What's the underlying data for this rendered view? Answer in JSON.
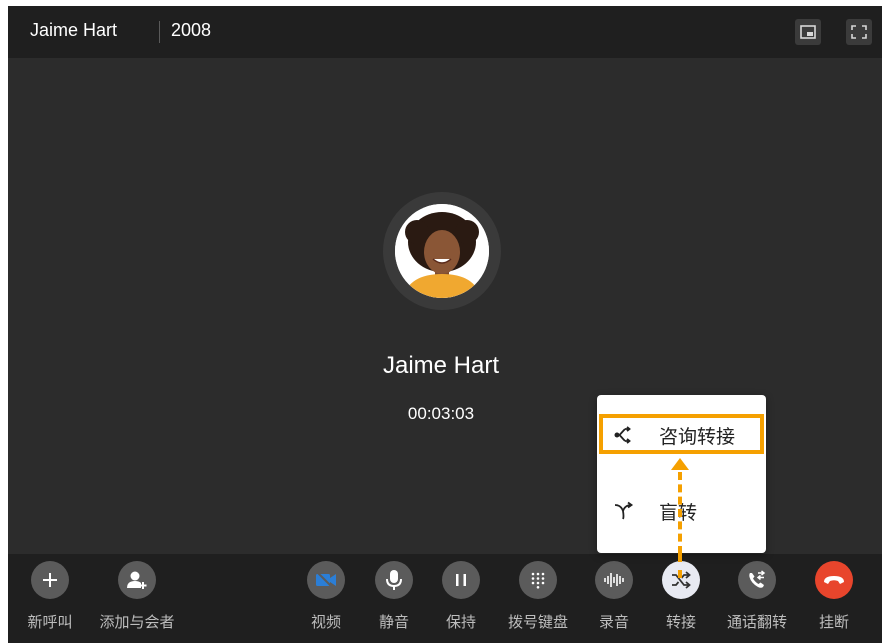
{
  "titlebar": {
    "name": "Jaime Hart",
    "extension": "2008",
    "buttons": [
      {
        "icon": "picture-in-picture-icon"
      },
      {
        "icon": "fullscreen-icon"
      }
    ]
  },
  "call": {
    "avatar_icon": "caller-avatar",
    "caller_name": "Jaime Hart",
    "duration": "00:03:03"
  },
  "toolbar": {
    "new_call": {
      "label": "新呼叫",
      "icon": "plus-icon"
    },
    "add_participant": {
      "label": "添加与会者",
      "icon": "add-user-icon"
    },
    "video": {
      "label": "视频",
      "icon": "video-off-icon"
    },
    "mute": {
      "label": "静音",
      "icon": "microphone-icon"
    },
    "hold": {
      "label": "保持",
      "icon": "pause-icon"
    },
    "dialpad": {
      "label": "拨号键盘",
      "icon": "dialpad-icon"
    },
    "record": {
      "label": "录音",
      "icon": "waveform-icon"
    },
    "transfer": {
      "label": "转接",
      "icon": "transfer-icon"
    },
    "flip": {
      "label": "通话翻转",
      "icon": "call-flip-icon"
    },
    "hangup": {
      "label": "挂断",
      "icon": "hangup-icon"
    }
  },
  "transfer_menu": {
    "items": [
      {
        "label": "咨询转接",
        "icon": "attended-transfer-icon"
      },
      {
        "label": "盲转",
        "icon": "blind-transfer-icon"
      }
    ]
  },
  "colors": {
    "window_bg": "#2c2c2c",
    "bar_bg": "#1f1f1f",
    "tool_circle": "#5b5b5b",
    "video_active": "#2b7ed6",
    "transfer_active": "#e8eaf2",
    "hangup": "#e8452c",
    "highlight": "#f5a000"
  }
}
